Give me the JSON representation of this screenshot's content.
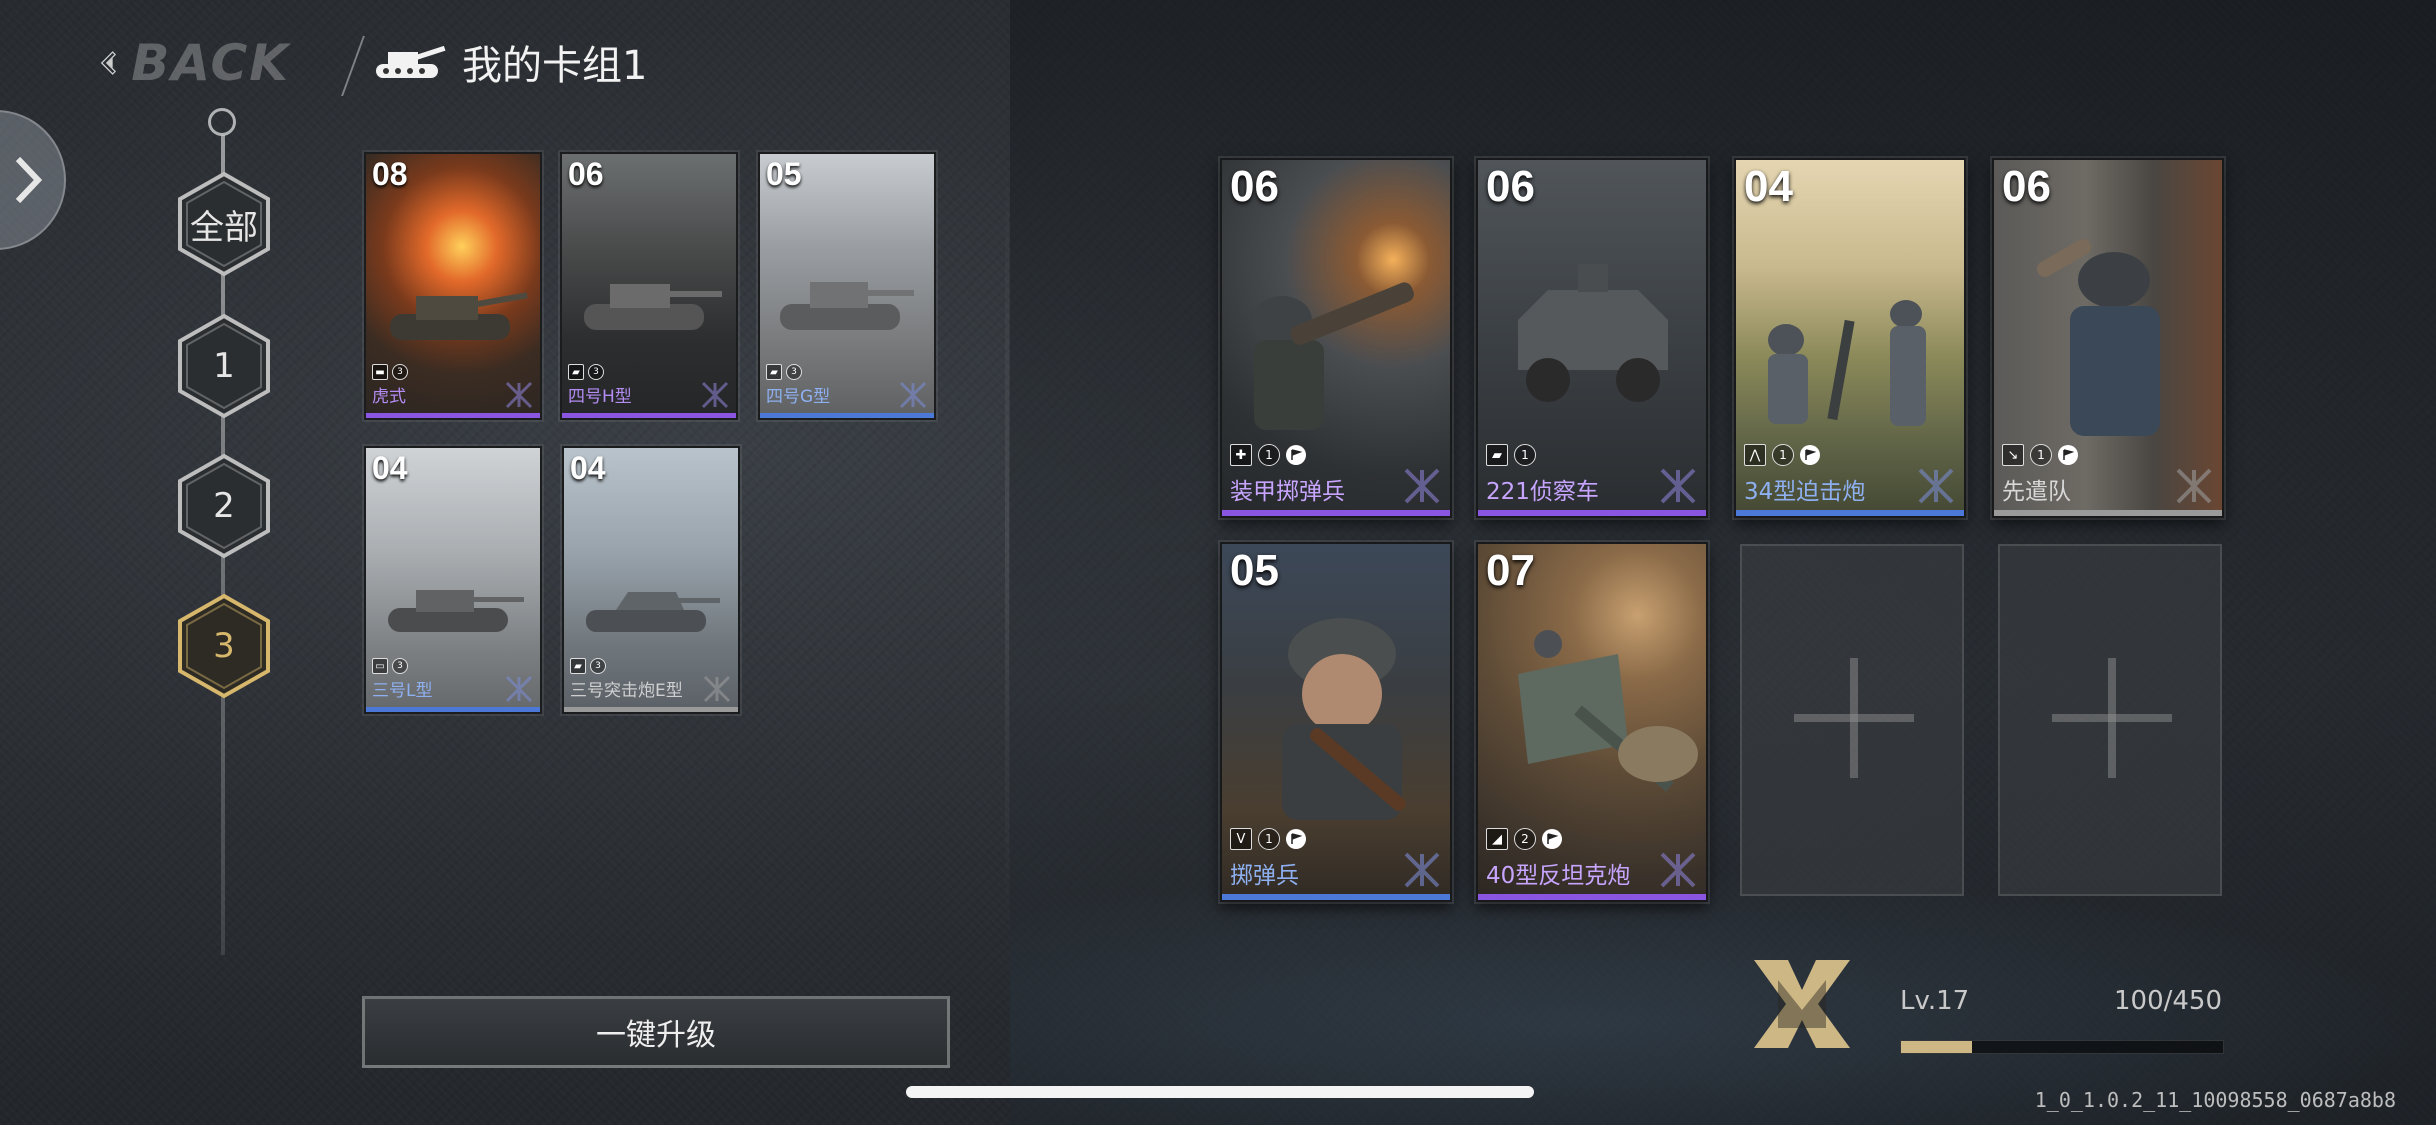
{
  "header": {
    "back_label": "BACK",
    "deck_title": "我的卡组1"
  },
  "tiers": [
    {
      "label": "全部",
      "active": false
    },
    {
      "label": "1",
      "active": false
    },
    {
      "label": "2",
      "active": false
    },
    {
      "label": "3",
      "active": true
    }
  ],
  "collection": [
    {
      "cost": "08",
      "name": "虎式",
      "stat": "3",
      "rarity_color": "#8a55e0",
      "name_color": "#b48cf3"
    },
    {
      "cost": "06",
      "name": "四号H型",
      "stat": "3",
      "rarity_color": "#8a55e0",
      "name_color": "#b48cf3"
    },
    {
      "cost": "05",
      "name": "四号G型",
      "stat": "3",
      "rarity_color": "#4c79d8",
      "name_color": "#8eb0f0"
    },
    {
      "cost": "04",
      "name": "三号L型",
      "stat": "3",
      "rarity_color": "#4c79d8",
      "name_color": "#8eb0f0"
    },
    {
      "cost": "04",
      "name": "三号突击炮E型",
      "stat": "3",
      "rarity_color": "#9a9a9a",
      "name_color": "#cfcfcf"
    }
  ],
  "deck": [
    {
      "cost": "06",
      "name": "装甲掷弹兵",
      "stat": "1",
      "type_icon": "medic-cross-icon",
      "type_glyph": "✚",
      "rarity_color": "#8a55e0",
      "name_color": "#c7a5ff"
    },
    {
      "cost": "06",
      "name": "221侦察车",
      "stat": "1",
      "type_icon": "vehicle-icon",
      "type_glyph": "▰",
      "rarity_color": "#8a55e0",
      "name_color": "#c7a5ff"
    },
    {
      "cost": "04",
      "name": "34型迫击炮",
      "stat": "1",
      "type_icon": "artillery-icon",
      "type_glyph": "⋀",
      "rarity_color": "#4c79d8",
      "name_color": "#8eb0f0"
    },
    {
      "cost": "06",
      "name": "先遣队",
      "stat": "1",
      "type_icon": "recon-icon",
      "type_glyph": "↘",
      "rarity_color": "#9a9a9a",
      "name_color": "#d8d8d8"
    },
    {
      "cost": "05",
      "name": "掷弹兵",
      "stat": "1",
      "type_icon": "infantry-icon",
      "type_glyph": "V",
      "rarity_color": "#4c79d8",
      "name_color": "#8eb0f0"
    },
    {
      "cost": "07",
      "name": "40型反坦克炮",
      "stat": "2",
      "type_icon": "antitank-icon",
      "type_glyph": "◢",
      "rarity_color": "#8a55e0",
      "name_color": "#c7a5ff"
    }
  ],
  "actions": {
    "upgrade_all": "一键升级"
  },
  "player": {
    "level": "Lv.17",
    "xp_text": "100/450",
    "xp_fraction": 0.222
  },
  "version": "1_0_1.0.2_11_10098558_0687a8b8",
  "colors": {
    "accent_gold": "#cdb785",
    "tier_active": "#d6b76c"
  }
}
